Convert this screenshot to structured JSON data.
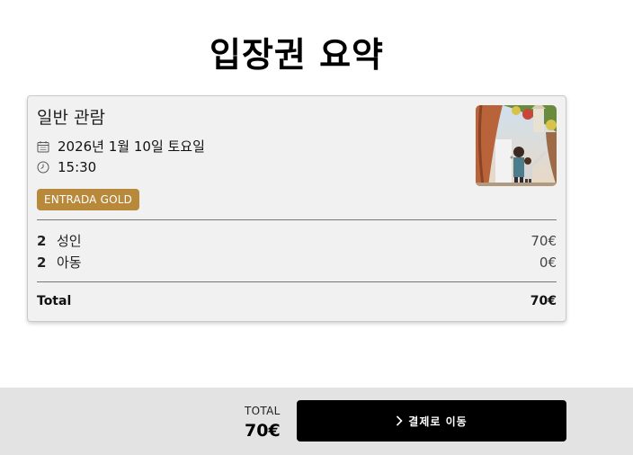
{
  "page": {
    "title": "입장권 요약"
  },
  "ticket": {
    "name": "일반 관람",
    "date": "2026년 1월 10일 토요일",
    "time": "15:30",
    "badge": "ENTRADA GOLD",
    "badge_color": "#b8893a",
    "image_icon": "park-photo"
  },
  "lines": [
    {
      "qty": "2",
      "label": "성인",
      "price": "70€"
    },
    {
      "qty": "2",
      "label": "아동",
      "price": "0€"
    }
  ],
  "summary": {
    "total_label": "Total",
    "total_value": "70€"
  },
  "footer": {
    "total_caption": "TOTAL",
    "total_amount": "70€",
    "checkout_label": "결제로 이동",
    "button_color": "#000000"
  }
}
